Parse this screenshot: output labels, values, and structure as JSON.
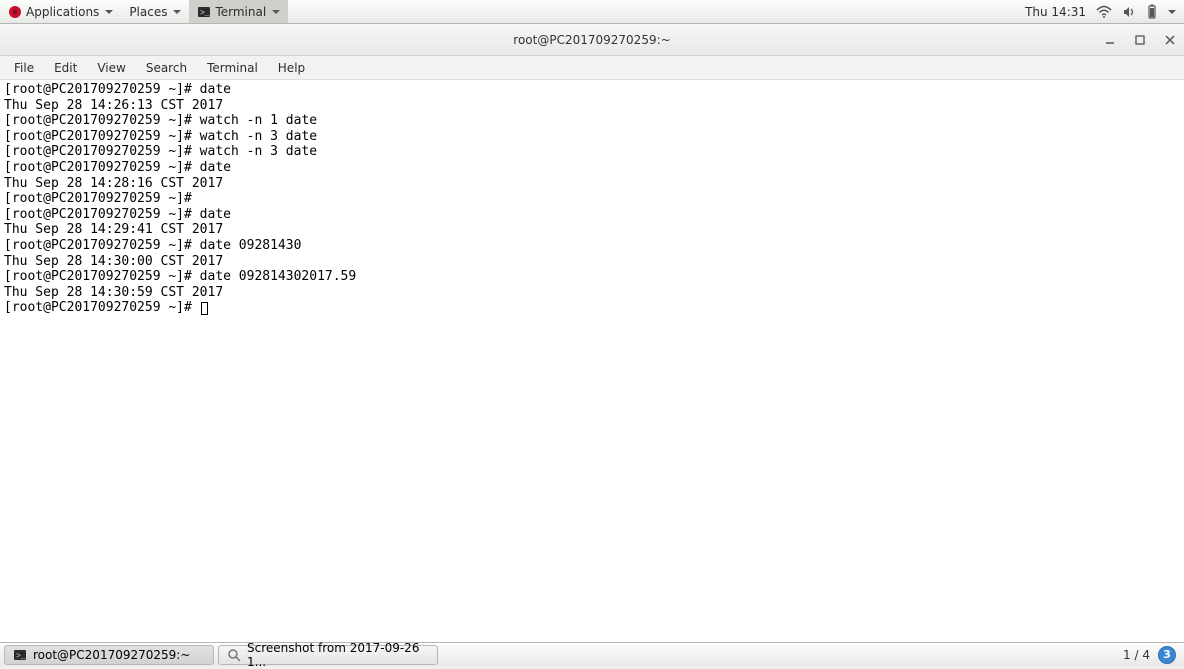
{
  "top_panel": {
    "applications": "Applications",
    "places": "Places",
    "terminal": "Terminal",
    "clock": "Thu 14:31"
  },
  "window": {
    "title": "root@PC201709270259:~"
  },
  "menubar": {
    "file": "File",
    "edit": "Edit",
    "view": "View",
    "search": "Search",
    "terminal": "Terminal",
    "help": "Help"
  },
  "terminal": {
    "lines": [
      "[root@PC201709270259 ~]# date",
      "Thu Sep 28 14:26:13 CST 2017",
      "[root@PC201709270259 ~]# watch -n 1 date",
      "[root@PC201709270259 ~]# watch -n 3 date",
      "[root@PC201709270259 ~]# watch -n 3 date",
      "[root@PC201709270259 ~]# date",
      "Thu Sep 28 14:28:16 CST 2017",
      "[root@PC201709270259 ~]# ",
      "[root@PC201709270259 ~]# date",
      "Thu Sep 28 14:29:41 CST 2017",
      "[root@PC201709270259 ~]# date 09281430",
      "Thu Sep 28 14:30:00 CST 2017",
      "[root@PC201709270259 ~]# date 092814302017.59",
      "Thu Sep 28 14:30:59 CST 2017"
    ],
    "prompt": "[root@PC201709270259 ~]# "
  },
  "taskbar": {
    "task1": "root@PC201709270259:~",
    "task2": "Screenshot from 2017-09-26 1...",
    "workspace": "1 / 4",
    "badge": "3"
  }
}
